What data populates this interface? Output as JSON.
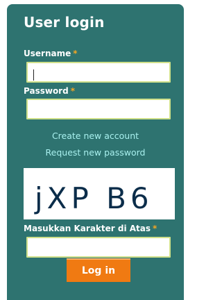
{
  "block": {
    "title": "User login"
  },
  "username": {
    "label": "Username",
    "required_mark": "*",
    "value": ""
  },
  "password": {
    "label": "Password",
    "required_mark": "*",
    "value": ""
  },
  "links": {
    "create_account": "Create new account",
    "request_password": "Request new password"
  },
  "captcha": {
    "image_text": "jXP B6",
    "label": "Masukkan Karakter di Atas",
    "required_mark": "*",
    "value": ""
  },
  "submit": {
    "label": "Log in"
  },
  "colors": {
    "panel_bg": "#2e7370",
    "required": "#f5a623",
    "link": "#a8f0ee",
    "input_border": "#cfe08a",
    "button_bg": "#f07a12",
    "captcha_ink": "#0b2d4a"
  }
}
